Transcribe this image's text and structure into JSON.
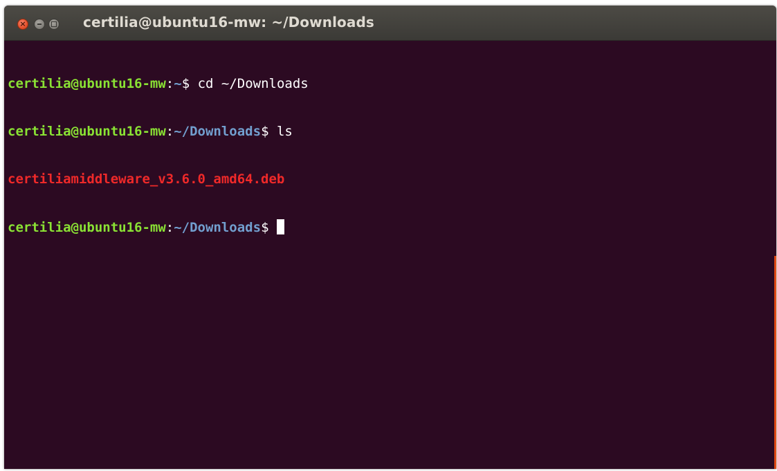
{
  "window": {
    "title": "certilia@ubuntu16-mw: ~/Downloads"
  },
  "terminal": {
    "lines": [
      {
        "user_host": "certilia@ubuntu16-mw",
        "sep": ":",
        "path": "~",
        "prompt": "$ ",
        "command": "cd ~/Downloads"
      },
      {
        "user_host": "certilia@ubuntu16-mw",
        "sep": ":",
        "path": "~/Downloads",
        "prompt": "$ ",
        "command": "ls"
      },
      {
        "output": "certiliamiddleware_v3.6.0_amd64.deb"
      },
      {
        "user_host": "certilia@ubuntu16-mw",
        "sep": ":",
        "path": "~/Downloads",
        "prompt": "$ ",
        "command": ""
      }
    ]
  },
  "colors": {
    "background": "#2c0a22",
    "user_host": "#8ae234",
    "path": "#729fcf",
    "deb_file": "#ef2929",
    "text": "#ffffff"
  }
}
